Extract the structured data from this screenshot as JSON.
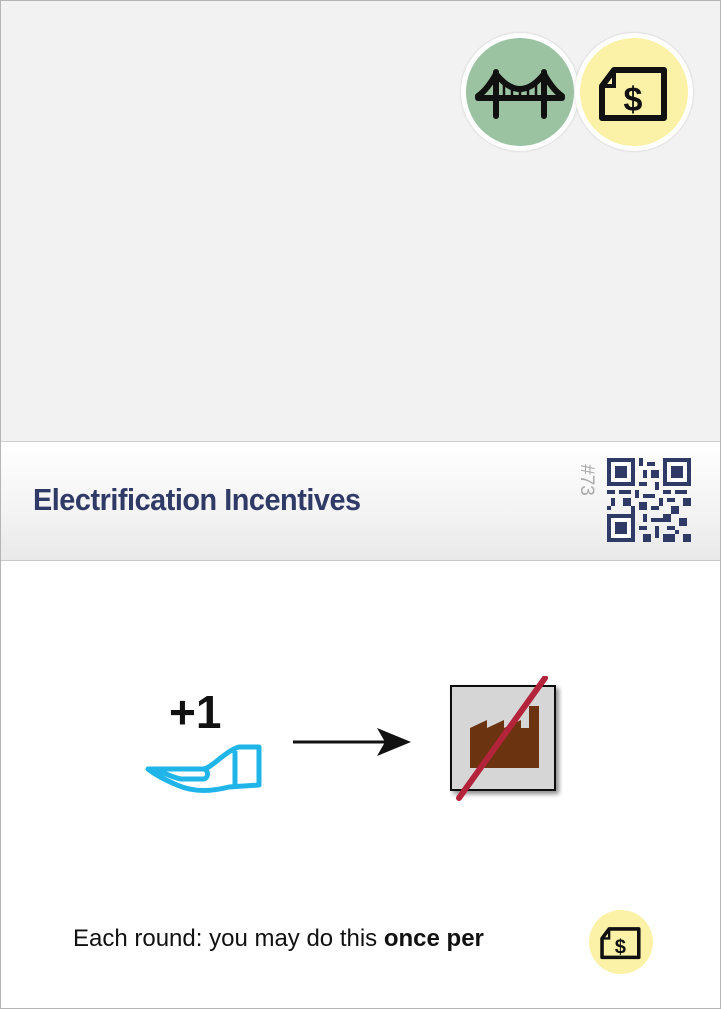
{
  "card": {
    "title": "Electrification Incentives",
    "number": "#73"
  },
  "tags": [
    {
      "name": "bridge-icon",
      "color": "#9bc3a2"
    },
    {
      "name": "money-icon",
      "color": "#fbf2a8"
    }
  ],
  "effect": {
    "gain": "+1",
    "gain_icon": "hand-icon",
    "target_icon": "factory-icon",
    "target_crossed": true,
    "hand_color": "#1fb5e8",
    "factory_color": "#6b3310",
    "cross_color": "#b3243a"
  },
  "footer": {
    "text_prefix": "Each round: you may do this ",
    "text_bold": "once per",
    "icon": "money-icon"
  },
  "colors": {
    "title": "#2f3a66",
    "art_background": "#f2f2f2"
  }
}
